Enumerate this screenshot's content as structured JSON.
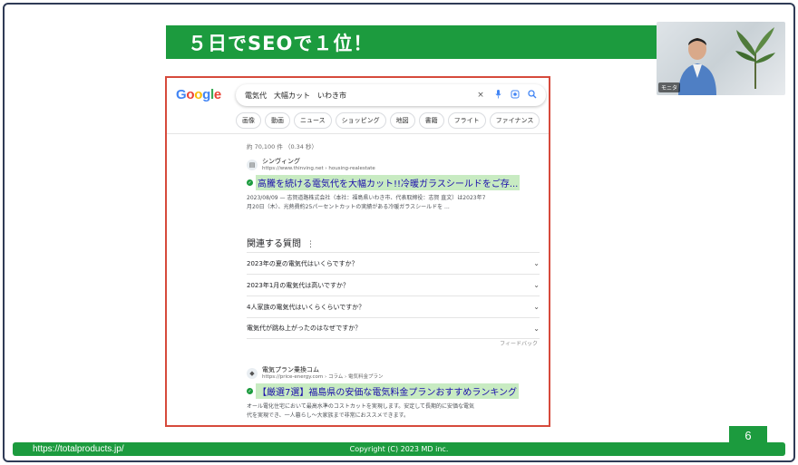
{
  "slide": {
    "title": "５日でSEOで１位！",
    "page_number": "6",
    "footer_url": "https://totalproducts.jp/",
    "copyright": "Copyright (C) 2023 MD inc."
  },
  "camera": {
    "name_tag": "モニタ"
  },
  "google": {
    "logo_letters": [
      "G",
      "o",
      "o",
      "g",
      "l",
      "e"
    ],
    "query": "電気代　大幅カット　いわき市",
    "icons": [
      "close-icon",
      "mic-icon",
      "lens-icon",
      "search-icon"
    ],
    "chips": [
      "画像",
      "動画",
      "ニュース",
      "ショッピング",
      "地図",
      "書籍",
      "フライト",
      "ファイナンス"
    ],
    "result_count": "約 70,100 件 （0.34 秒）",
    "results": [
      {
        "site_name": "シンヴィング",
        "site_url": "https://www.thinving.net › housing-realestate",
        "headline": "高騰を続ける電気代を大幅カット!!冷暖ガラスシールドをご存...",
        "snippet_line1": "2023/08/09 — 志賀道路株式会社（本社：福島県いわき市、代表取締役：志賀 直文）は2023年7",
        "snippet_line2": "月20日（木）、光熱費約25パーセントカットの実績がある冷暖ガラスシールドを ..."
      },
      {
        "site_name": "電気プラン乗換コム",
        "site_url": "https://price-energy.com › コラム › 電気料金プラン",
        "headline": "【厳選7選】福島県の安価な電気料金プランおすすめランキング",
        "snippet_line1": "オール電化住宅において最高水準のコストカットを実現します。安定して長期的に安価な電気",
        "snippet_line2": "代を実現でき、一人暮らし〜大家族まで非常におススメできます。"
      }
    ],
    "paa_title": "関連する質問",
    "paa_items": [
      "2023年の夏の電気代はいくらですか？",
      "2023年1月の電気代は高いですか？",
      "4人家族の電気代はいくらくらいですか？",
      "電気代が跳ね上がったのはなぜですか？"
    ],
    "feedback": "フィードバック"
  }
}
